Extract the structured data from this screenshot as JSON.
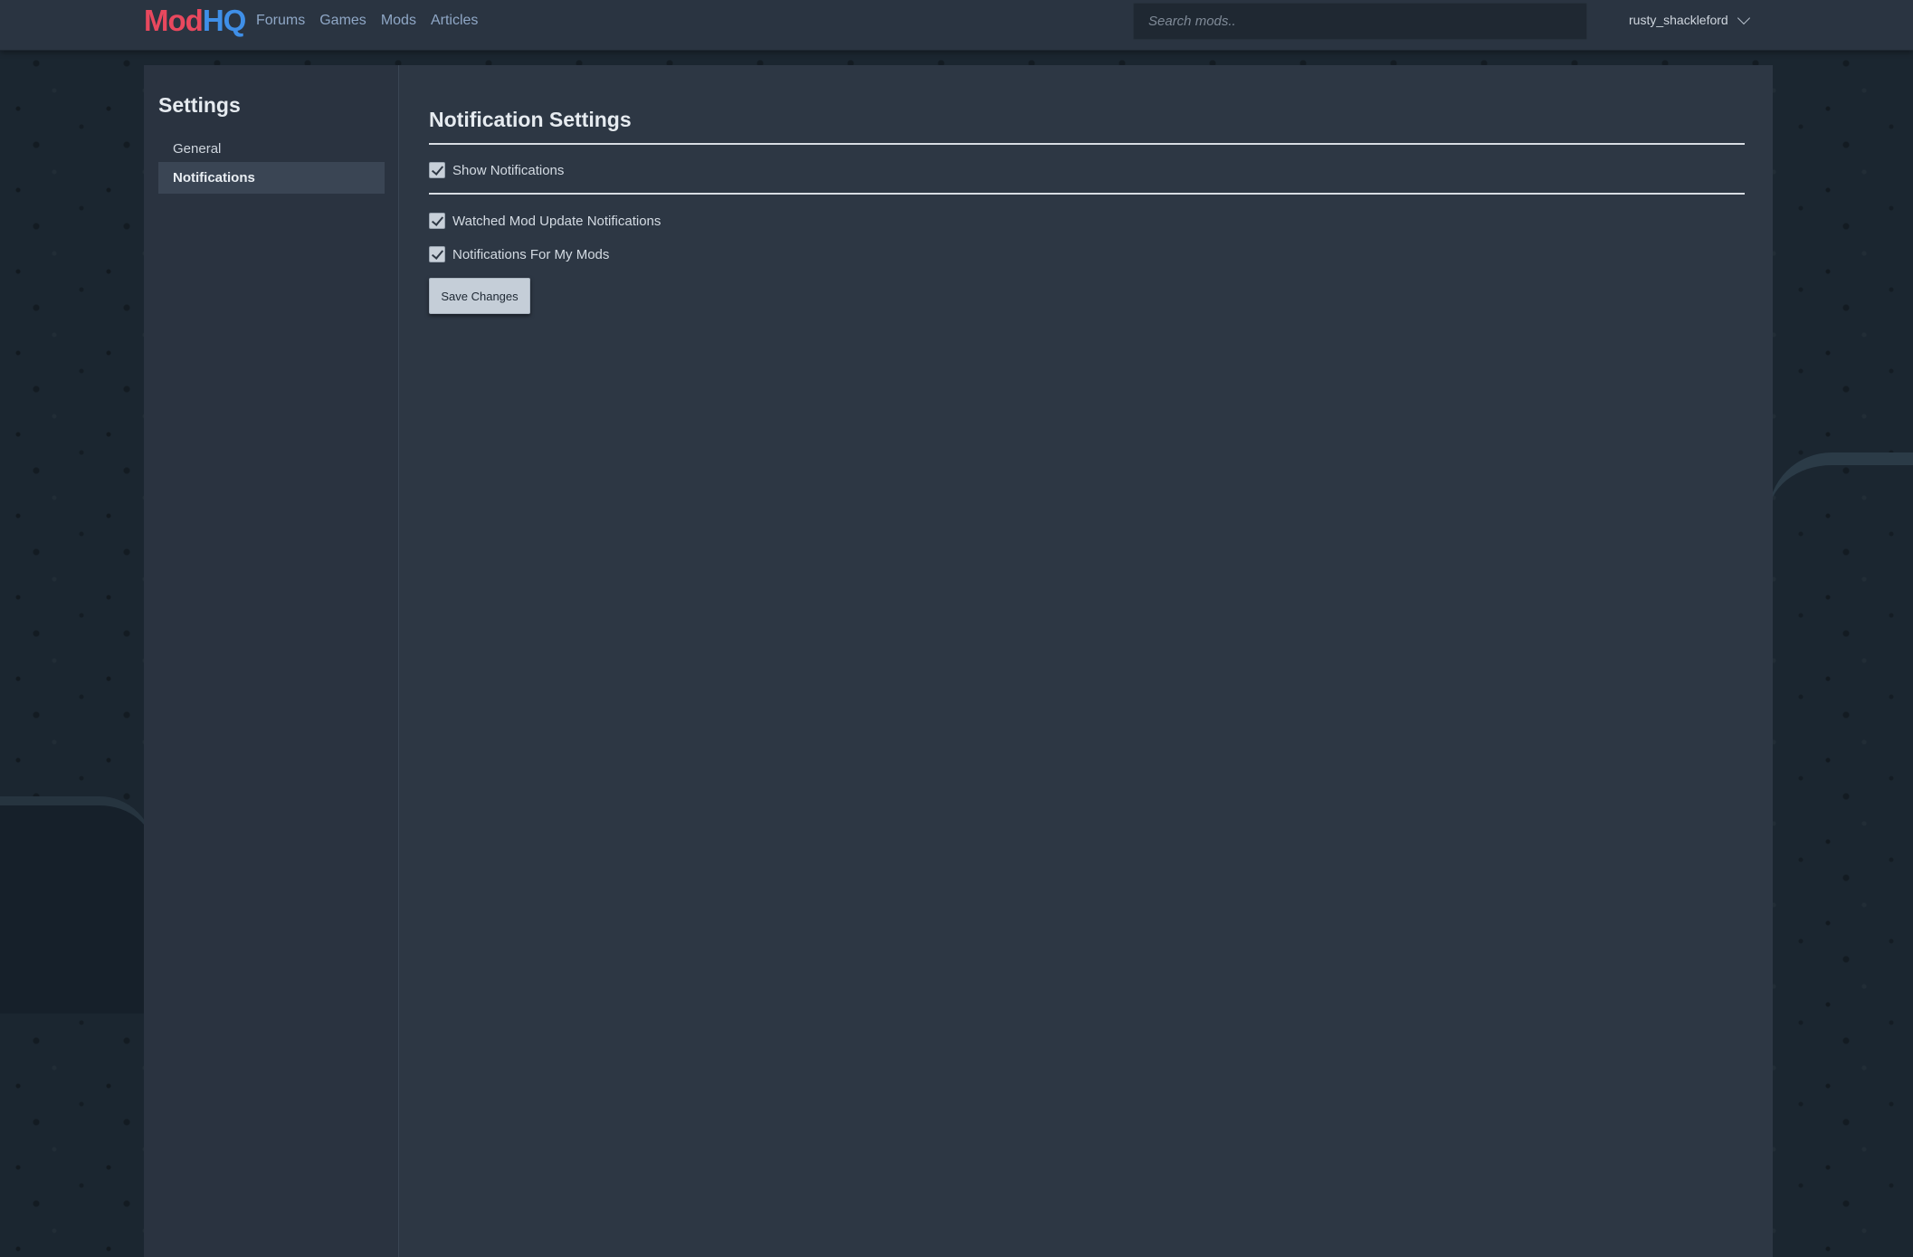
{
  "brand": {
    "part1": "Mod",
    "part2": "HQ"
  },
  "nav": {
    "items": [
      "Forums",
      "Games",
      "Mods",
      "Articles"
    ]
  },
  "search": {
    "placeholder": "Search mods.."
  },
  "user": {
    "name": "rusty_shackleford"
  },
  "sidebar": {
    "title": "Settings",
    "items": [
      {
        "label": "General",
        "active": false
      },
      {
        "label": "Notifications",
        "active": true
      }
    ]
  },
  "main": {
    "title": "Notification Settings",
    "show_notifications": {
      "label": "Show Notifications",
      "checked": true
    },
    "options": [
      {
        "label": "Watched Mod Update Notifications",
        "checked": true
      },
      {
        "label": "Notifications For My Mods",
        "checked": true
      }
    ],
    "save_label": "Save Changes"
  },
  "colors": {
    "brand_mod": "#e8485e",
    "brand_hq": "#3f8fe8",
    "nav_link": "#8fa7c6",
    "panel_bg": "#2d3744"
  }
}
